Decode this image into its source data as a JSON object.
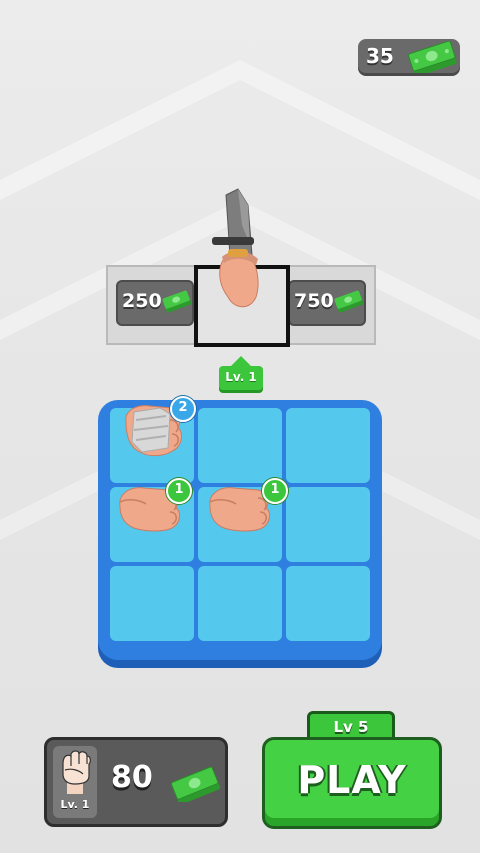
{
  "currency": {
    "amount": "35",
    "icon": "cash-stack-icon"
  },
  "shop": {
    "left_slot_price": "250",
    "right_slot_price": "750",
    "center_weapon_icon": "knife-hand-icon",
    "price_icon": "cash-stack-icon"
  },
  "level_tag": {
    "label": "Lv. 1"
  },
  "board": {
    "rows": 3,
    "cols": 3,
    "units": [
      {
        "row": 0,
        "col": 0,
        "level": "2",
        "icon": "bandaged-fist-icon"
      },
      {
        "row": 1,
        "col": 0,
        "level": "1",
        "icon": "fist-icon"
      },
      {
        "row": 1,
        "col": 1,
        "level": "1",
        "icon": "fist-icon"
      }
    ]
  },
  "buy_unit": {
    "level_label": "Lv. 1",
    "cost": "80",
    "icon": "raised-fist-icon",
    "cost_icon": "cash-stack-icon"
  },
  "stage": {
    "label": "Lv 5"
  },
  "play_button": {
    "label": "PLAY"
  },
  "colors": {
    "board": "#2f7fe0",
    "cell": "#55c8ee",
    "accent_green": "#44d144",
    "badge_green": "#3cc63c",
    "panel_gray": "#5a5a5a"
  }
}
